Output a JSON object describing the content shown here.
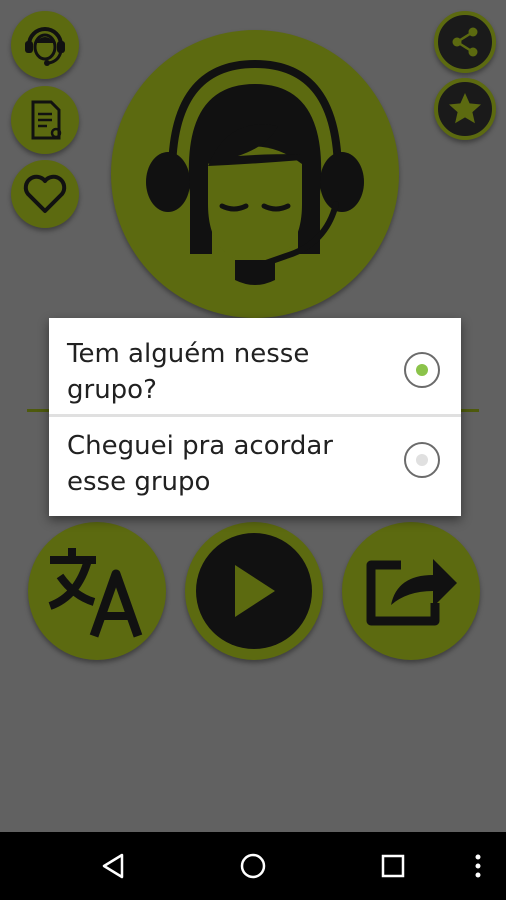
{
  "dialog": {
    "options": [
      {
        "label": "Tem alguém nesse grupo?",
        "selected": true
      },
      {
        "label": "Cheguei pra acordar esse grupo",
        "selected": false
      }
    ]
  },
  "toolbar": {
    "left": [
      "headset-icon",
      "document-icon",
      "heart-icon"
    ],
    "right": [
      "share-icon",
      "star-icon"
    ]
  },
  "main_icon": "headset-woman-icon",
  "action_buttons": [
    "translate-icon",
    "play-icon",
    "share-forward-icon"
  ],
  "navbar": [
    "back-icon",
    "home-icon",
    "recents-icon",
    "more-icon"
  ],
  "colors": {
    "background": "#616161",
    "olive": "#5c6a10",
    "dark": "#1a1a1a",
    "radio_selected": "#8bc34a"
  }
}
